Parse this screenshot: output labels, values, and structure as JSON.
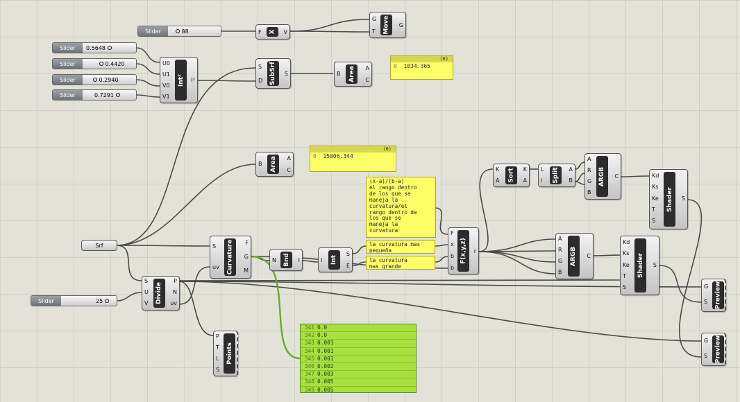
{
  "sliders": [
    {
      "label": "Slider",
      "value": "88"
    },
    {
      "label": "Slider",
      "value": "0.5648"
    },
    {
      "label": "Slider",
      "value": "0.4420"
    },
    {
      "label": "Slider",
      "value": "0.2940"
    },
    {
      "label": "Slider",
      "value": "0.7291"
    },
    {
      "label": "Slider",
      "value": "25"
    }
  ],
  "components": {
    "x": {
      "title": "X",
      "in": [
        "F"
      ],
      "out": [
        "V"
      ]
    },
    "move": {
      "title": "Move",
      "in": [
        "G",
        "T"
      ],
      "out": [
        "G"
      ]
    },
    "int2": {
      "title": "Int²",
      "in": [
        "U0",
        "U1",
        "V0",
        "V1"
      ],
      "out": [
        "I²"
      ]
    },
    "subsrf": {
      "title": "SubSrf",
      "in": [
        "S",
        "D"
      ],
      "out": [
        "S"
      ]
    },
    "area1": {
      "title": "Area",
      "in": [
        "B"
      ],
      "out": [
        "A",
        "C"
      ]
    },
    "area2": {
      "title": "Area",
      "in": [
        "B"
      ],
      "out": [
        "A",
        "C"
      ]
    },
    "srf": {
      "title": "Srf"
    },
    "curvature": {
      "title": "Curvature",
      "in": [
        "S",
        "uv"
      ],
      "out": [
        "F",
        "G",
        "M"
      ]
    },
    "bnd": {
      "title": "Bnd",
      "in": [
        "N"
      ],
      "out": [
        "I"
      ]
    },
    "int": {
      "title": "Int",
      "in": [
        "I"
      ],
      "out": [
        "S",
        "E"
      ]
    },
    "divide": {
      "title": "Divide",
      "in": [
        "S",
        "U",
        "V"
      ],
      "out": [
        "P",
        "N",
        "uv"
      ]
    },
    "points": {
      "title": "Points",
      "in": [
        "P",
        "T",
        "L",
        "S"
      ]
    },
    "fxyz": {
      "title": "F(x,y,z)",
      "in": [
        "F",
        "x",
        "b",
        "b"
      ],
      "out": [
        "r"
      ]
    },
    "sort": {
      "title": "Sort",
      "in": [
        "K",
        "A"
      ],
      "out": [
        "K",
        "A"
      ]
    },
    "split": {
      "title": "Split",
      "in": [
        "L",
        "i"
      ],
      "out": [
        "A",
        "B"
      ]
    },
    "argb1": {
      "title": "ARGB",
      "in": [
        "A",
        "R",
        "G",
        "B"
      ],
      "out": [
        "C"
      ]
    },
    "argb2": {
      "title": "ARGB",
      "in": [
        "A",
        "R",
        "G",
        "B"
      ],
      "out": [
        "C"
      ]
    },
    "shader1": {
      "title": "Shader",
      "in": [
        "Kd",
        "Ks",
        "Ke",
        "T",
        "S"
      ],
      "out": [
        "S"
      ]
    },
    "shader2": {
      "title": "Shader",
      "in": [
        "Kd",
        "Ks",
        "Ke",
        "T",
        "S"
      ],
      "out": [
        "S"
      ]
    },
    "preview1": {
      "title": "Preview",
      "in": [
        "G",
        "S"
      ]
    },
    "preview2": {
      "title": "Preview",
      "in": [
        "G",
        "S"
      ]
    }
  },
  "panels": [
    {
      "header": "(0)",
      "index": "0",
      "value": "1034.365"
    },
    {
      "header": "(0)",
      "index": "0",
      "value": "15006.344"
    }
  ],
  "notes": [
    "(x-a)/(b-a)\nel rango dentro\nde los que se\nmaneja la\ncurvatura/el\nrango dentro de\nlos que se\nmaneja la\ncurvatura",
    "la curvatura mas\npequeña",
    "la curvatura\nmas grande"
  ],
  "list_panel": {
    "rows": [
      {
        "i": "341",
        "v": "0.0"
      },
      {
        "i": "342",
        "v": "0.0"
      },
      {
        "i": "343",
        "v": "0.001"
      },
      {
        "i": "344",
        "v": "0.001"
      },
      {
        "i": "345",
        "v": "0.001"
      },
      {
        "i": "346",
        "v": "0.002"
      },
      {
        "i": "347",
        "v": "0.003"
      },
      {
        "i": "348",
        "v": "0.005"
      },
      {
        "i": "349",
        "v": "0.005"
      }
    ]
  },
  "colors": {
    "canvas": "#e2e2d8",
    "wire": "#4a4a4a",
    "green_wire": "#5fae2a",
    "panel_yellow": "#ffff66",
    "list_green": "#a8e040",
    "title_black": "#2c2c2c"
  }
}
